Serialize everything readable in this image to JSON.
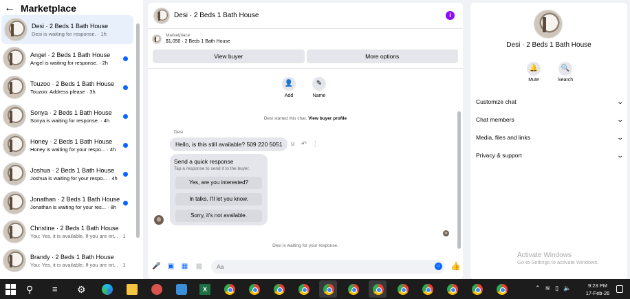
{
  "left": {
    "back_icon": "arrow-left-icon",
    "title": "Marketplace",
    "conversations": [
      {
        "name": "Desi · 2 Beds 1 Bath House",
        "preview": "Desi is waiting for response. · 1h",
        "unread": false,
        "active": true
      },
      {
        "name": "Angel · 2 Beds 1 Bath House",
        "preview": "Angel is waiting for response. · 2h",
        "unread": true,
        "active": false
      },
      {
        "name": "Touzoo · 2 Beds 1 Bath House",
        "preview": "Touzoo: Address please · 3h",
        "unread": true,
        "active": false
      },
      {
        "name": "Sonya · 2 Beds 1 Bath House",
        "preview": "Sonya is waiting for response. · 4h",
        "unread": true,
        "active": false
      },
      {
        "name": "Honey · 2 Beds 1 Bath House",
        "preview": "Honey is waiting for your respo... · 4h",
        "unread": true,
        "active": false
      },
      {
        "name": "Joshua · 2 Beds 1 Bath House",
        "preview": "Joshua is waiting for your respo... · 4h",
        "unread": true,
        "active": false
      },
      {
        "name": "Jonathan · 2 Beds 1 Bath House",
        "preview": "Jonathan is waiting for your res... · 8h",
        "unread": true,
        "active": false
      },
      {
        "name": "Christine · 2 Beds 1 Bath House",
        "preview": "You: Yes, it is available. If you are int... · 1d",
        "unread": false,
        "active": false
      },
      {
        "name": "Brandy · 2 Beds 1 Bath House",
        "preview": "You: Yes, it is available. If you are int... · 1d",
        "unread": false,
        "active": false
      }
    ]
  },
  "chat": {
    "title": "Desi · 2 Beds 1 Bath House",
    "info_icon": "info-icon",
    "marketplace_label": "Marketplace",
    "listing": "$1,050 · 2 Beds 1 Bath House",
    "view_buyer": "View buyer",
    "more_options": "More options",
    "add_label": "Add",
    "name_label": "Name",
    "started_text": "Desi started this chat.",
    "view_profile": "View buyer profile",
    "sender": "Desi",
    "message": "Hello, is this still available? 509 220 5051",
    "quick_title": "Send a quick response",
    "quick_sub": "Tap a response to send it to the buyer.",
    "quick_replies": [
      "Yes, are you interested?",
      "In talks. I'll let you know.",
      "Sorry, it's not available."
    ],
    "waiting": "Desi is waiting for your response.",
    "composer_placeholder": "Aa"
  },
  "details": {
    "title": "Desi · 2 Beds 1 Bath House",
    "mute": "Mute",
    "search": "Search",
    "menu": [
      "Customize chat",
      "Chat members",
      "Media, files and links",
      "Privacy & support"
    ]
  },
  "watermark": {
    "line1": "Activate Windows",
    "line2": "Go to Settings to activate Windows."
  },
  "taskbar": {
    "time": "9:23 PM",
    "date": "17-Feb-26",
    "excel_letter": "X"
  }
}
